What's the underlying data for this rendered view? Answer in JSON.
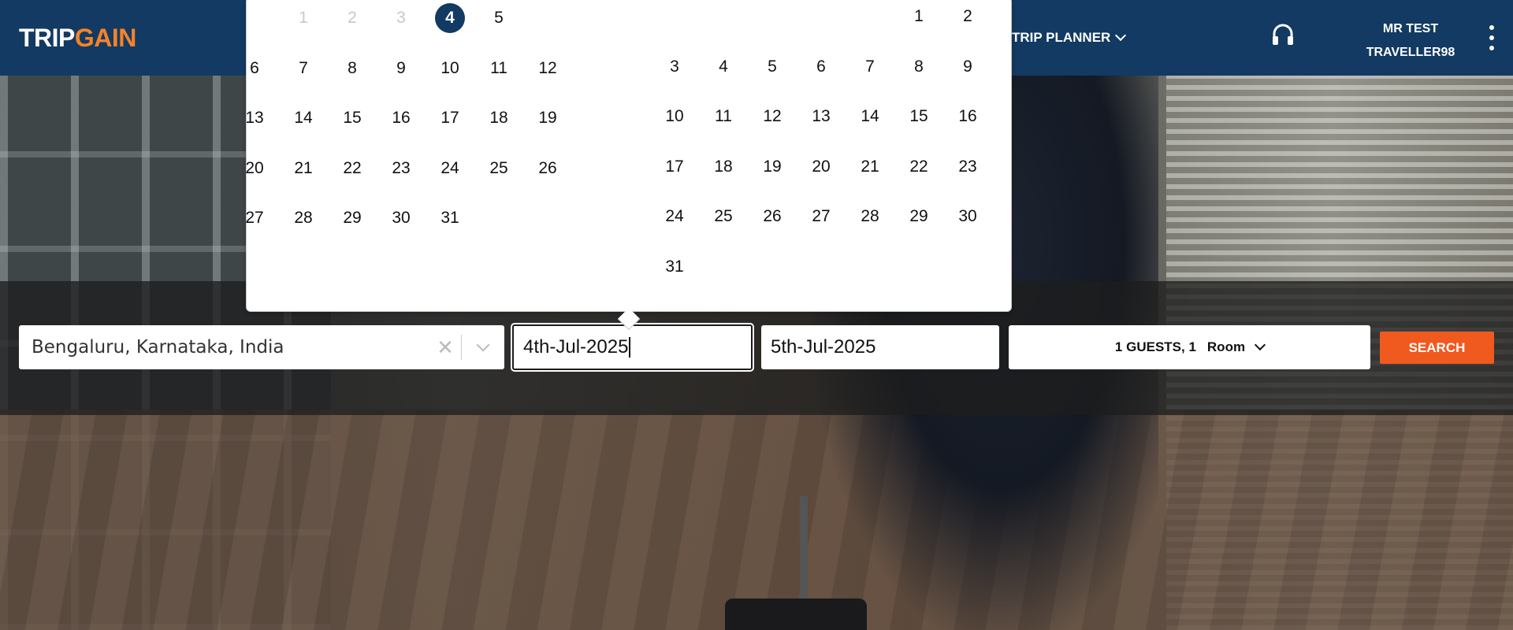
{
  "header": {
    "logo_trip": "TRIP",
    "logo_gain": "GAIN",
    "nav_trip_planner": "TRIP PLANNER",
    "user_line1": "MR TEST",
    "user_line2": "TRAVELLER98"
  },
  "search": {
    "city_value": "Bengaluru, Karnataka, India",
    "clear_glyph": "✕",
    "checkin_value": "4th-Jul-2025",
    "checkout_value": "5th-Jul-2025",
    "guests_label": "1 GUESTS, 1",
    "room_label": "Room",
    "search_label": "SEARCH"
  },
  "calendar": {
    "left_month": {
      "weeks": [
        [
          "",
          "1",
          "2",
          "3",
          "4",
          "5",
          ""
        ],
        [
          "6",
          "7",
          "8",
          "9",
          "10",
          "11",
          "12"
        ],
        [
          "13",
          "14",
          "15",
          "16",
          "17",
          "18",
          "19"
        ],
        [
          "20",
          "21",
          "22",
          "23",
          "24",
          "25",
          "26"
        ],
        [
          "27",
          "28",
          "29",
          "30",
          "31",
          "",
          ""
        ]
      ],
      "disabled": [
        "1",
        "2",
        "3"
      ],
      "selected": "4"
    },
    "right_month": {
      "weeks": [
        [
          "",
          "",
          "",
          "",
          "",
          "1",
          "2"
        ],
        [
          "3",
          "4",
          "5",
          "6",
          "7",
          "8",
          "9"
        ],
        [
          "10",
          "11",
          "12",
          "13",
          "14",
          "15",
          "16"
        ],
        [
          "17",
          "18",
          "19",
          "20",
          "21",
          "22",
          "23"
        ],
        [
          "24",
          "25",
          "26",
          "27",
          "28",
          "29",
          "30"
        ],
        [
          "31",
          "",
          "",
          "",
          "",
          "",
          ""
        ]
      ]
    }
  },
  "colors": {
    "header_bg": "#123a62",
    "accent_orange": "#f05a1f",
    "logo_orange": "#f5822a"
  }
}
